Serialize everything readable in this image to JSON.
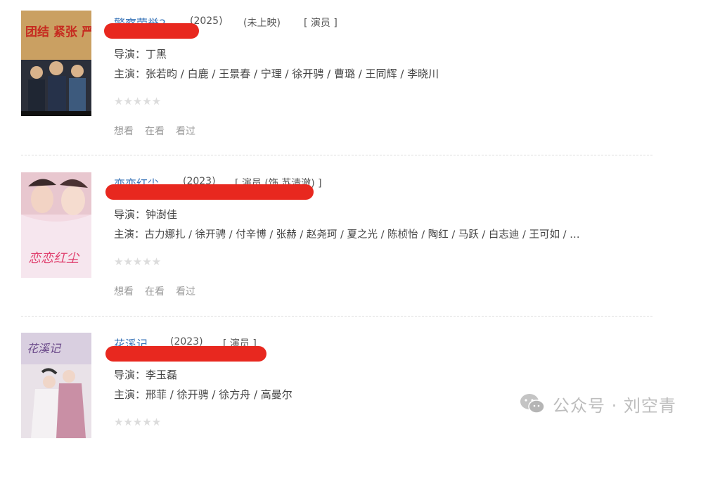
{
  "movies": [
    {
      "title": "警察荣誉2",
      "year": "(2025)",
      "status": "(未上映)",
      "role": "[ 演员 ]",
      "director_label": "导演：",
      "director": "丁黑",
      "cast_label": "主演：",
      "cast": "张若昀 / 白鹿 / 王景春 / 宁理 / 徐开骋 / 曹璐 / 王同辉 / 李晓川",
      "stars": "★★★★★",
      "actions": [
        "想看",
        "在看",
        "看过"
      ],
      "poster_text": "团结 紧张 严肃 活泼"
    },
    {
      "title": "恋恋红尘",
      "year": "(2023)",
      "status": "",
      "role": "[ 演员 (饰 苏清澈) ]",
      "director_label": "导演：",
      "director": "钟澍佳",
      "cast_label": "主演：",
      "cast": "古力娜扎 / 徐开骋 / 付辛博 / 张赫 / 赵尧珂 / 夏之光 / 陈桢怡 / 陶红 / 马跃 / 白志迪 / 王可如 / …",
      "stars": "★★★★★",
      "actions": [
        "想看",
        "在看",
        "看过"
      ],
      "poster_text": "恋恋红尘"
    },
    {
      "title": "花溪记",
      "year": "(2023)",
      "status": "",
      "role": "[ 演员 ]",
      "director_label": "导演：",
      "director": "李玉磊",
      "cast_label": "主演：",
      "cast": "邢菲 / 徐开骋 / 徐方舟 / 高曼尔",
      "stars": "★★★★★",
      "actions": [
        "想看",
        "在看",
        "看过"
      ],
      "poster_text": "花溪记"
    }
  ],
  "watermark": "公众号 · 刘空青",
  "colors": {
    "link": "#3a75b8",
    "redaction": "#e8281f",
    "muted": "#9a9a9a"
  }
}
